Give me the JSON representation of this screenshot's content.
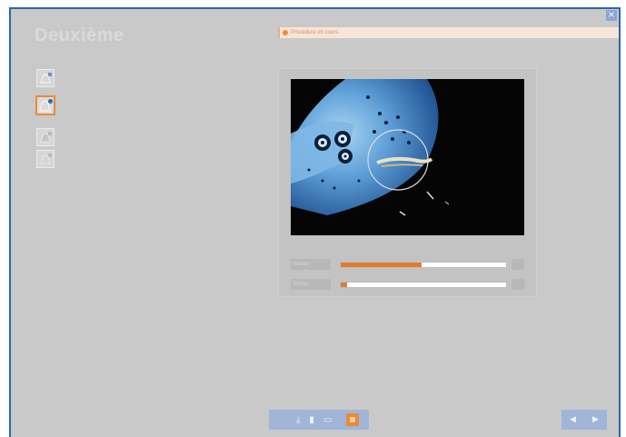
{
  "window": {
    "title": "Deuxième"
  },
  "info_bar": {
    "message": "Procédure en cours"
  },
  "tools": [
    {
      "icon": "dome-add-icon",
      "state": "normal"
    },
    {
      "icon": "dome-active-icon",
      "state": "active"
    },
    {
      "icon": "dome-disabled-icon",
      "state": "disabled"
    },
    {
      "icon": "dome-image-icon",
      "state": "disabled"
    }
  ],
  "viewer": {
    "slider_1": {
      "label": "Niveau",
      "value_percent": 49
    },
    "slider_2": {
      "label": "Temps",
      "value_percent": 4
    }
  },
  "toolbar": {
    "icons": [
      "download-icon",
      "bookmark-icon",
      "film-icon",
      "record-icon"
    ]
  },
  "navigation": {
    "prev_label": "◀",
    "next_label": "▶"
  },
  "colors": {
    "window_border": "#2a66b4",
    "accent": "#e88a38",
    "panel": "#c9c9c9",
    "toolbar": "#9fb6d8"
  }
}
